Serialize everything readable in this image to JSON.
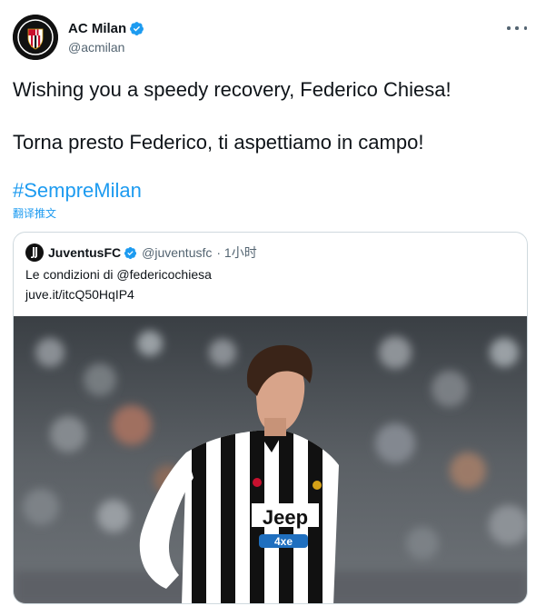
{
  "tweet": {
    "author": {
      "display_name": "AC Milan",
      "handle": "@acmilan",
      "verified": true,
      "avatar_icon": "ac-milan-crest-icon"
    },
    "more_icon": "more-dots-icon",
    "lines": [
      "Wishing you a speedy recovery, Federico Chiesa!",
      "Torna presto Federico, ti aspettiamo in campo!"
    ],
    "hashtag": "#SempreMilan",
    "translate_label": "翻译推文"
  },
  "quote": {
    "author": {
      "display_name": "JuventusFC",
      "handle": "@juventusfc",
      "time": "· 1小时",
      "verified": true,
      "avatar_icon": "juventus-logo-icon"
    },
    "text": "Le condizioni di @federicochiesa",
    "link": "juve.it/itcQ50HqIP4",
    "image_icon": "player-photo",
    "shirt_sponsor": "Jeep",
    "shirt_sleeve_sponsor": "4xe"
  },
  "colors": {
    "accent": "#1d9bf0",
    "text": "#0f1419",
    "secondary": "#536471",
    "border": "#cfd9de"
  }
}
